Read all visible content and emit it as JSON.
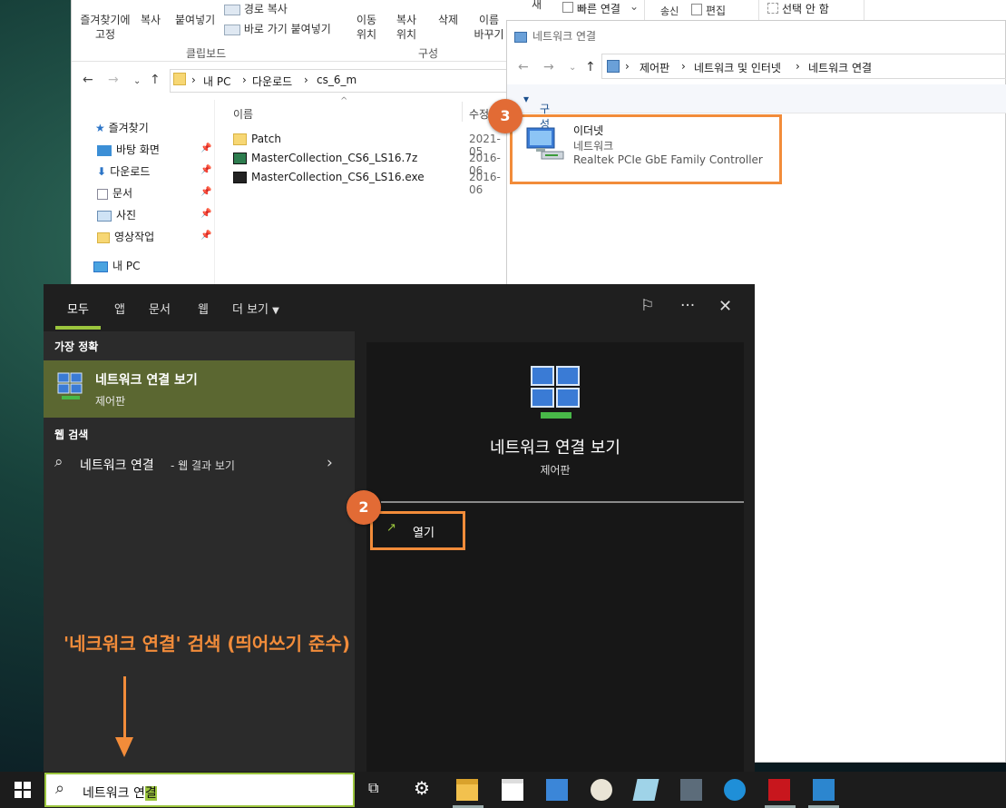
{
  "explorer": {
    "ribbon": {
      "pin_label": "즐겨찾기에 고정",
      "copy_label": "복사",
      "paste_label": "붙여넣기",
      "copy_path_label": "경로 복사",
      "paste_shortcut_label": "바로 가기 붙여넣기",
      "move_to_label": "이동 위치",
      "copy_to_label": "복사 위치",
      "delete_label": "삭제",
      "rename_label": "이름 바꾸기",
      "clipboard_group": "클립보드",
      "organize_group": "구성"
    },
    "address": [
      "내 PC",
      "다운로드",
      "cs_6_m"
    ],
    "tree": [
      {
        "label": "즐겨찾기",
        "icon": "star-icon"
      },
      {
        "label": "바탕 화면",
        "icon": "desktop-icon"
      },
      {
        "label": "다운로드",
        "icon": "download-icon"
      },
      {
        "label": "문서",
        "icon": "document-icon"
      },
      {
        "label": "사진",
        "icon": "picture-icon"
      },
      {
        "label": "영상작업",
        "icon": "folder-icon"
      },
      {
        "label": "내 PC",
        "icon": "pc-icon"
      }
    ],
    "columns": {
      "name": "이름",
      "modified": "수정"
    },
    "files": [
      {
        "name": "Patch",
        "date": "2021-05",
        "icon": "folder-icon"
      },
      {
        "name": "MasterCollection_CS6_LS16.7z",
        "date": "2016-06",
        "icon": "archive-icon"
      },
      {
        "name": "MasterCollection_CS6_LS16.exe",
        "date": "2016-06",
        "icon": "exe-icon"
      }
    ]
  },
  "network_window": {
    "ribbon_partial": {
      "quick_connect": "빠른 연결",
      "edit": "편집",
      "select_none": "선택 안 함",
      "send": "송신",
      "new": "새"
    },
    "title": "네트워크 연결",
    "breadcrumb": [
      "제어판",
      "네트워크 및 인터넷",
      "네트워크 연결"
    ],
    "organize": "구성",
    "adapter": {
      "name": "이더넷",
      "status": "네트워크",
      "device": "Realtek PCIe GbE Family Controller"
    }
  },
  "search_panel": {
    "tabs": [
      "모두",
      "앱",
      "문서",
      "웹",
      "더 보기"
    ],
    "best_match_header": "가장 정확",
    "best_match": {
      "title": "네트워크 연결 보기",
      "subtitle": "제어판"
    },
    "web_header": "웹 검색",
    "web_result": {
      "query": "네트워크 연결",
      "suffix": "- 웹 결과 보기"
    },
    "preview": {
      "title": "네트워크 연결 보기",
      "subtitle": "제어판",
      "open_label": "열기"
    }
  },
  "annotations": {
    "step2": "2",
    "step3": "3",
    "caption": "'네크워크 연결' 검색 (띄어쓰기 준수)"
  },
  "taskbar": {
    "search_text": "네트워크 연",
    "search_highlight": "결"
  },
  "colors": {
    "accent": "#9bc53d",
    "highlight": "#f28c3a",
    "badge": "#e26b35"
  }
}
